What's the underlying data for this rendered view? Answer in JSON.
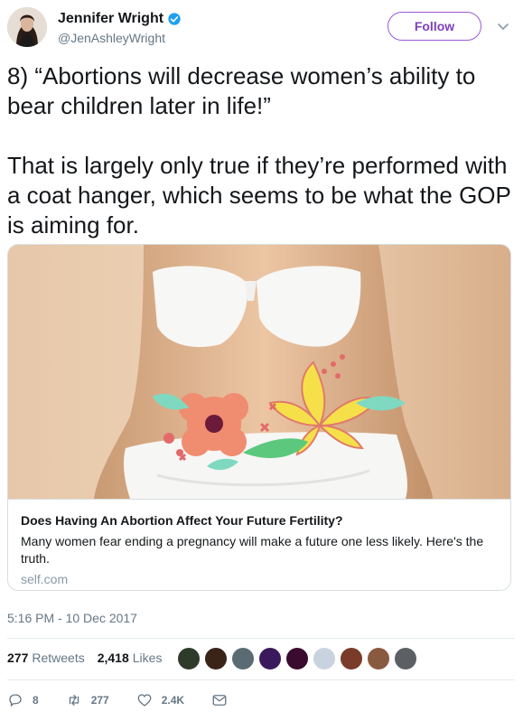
{
  "author": {
    "name": "Jennifer Wright",
    "handle": "@JenAshleyWright",
    "verified_icon": "verified-badge-icon"
  },
  "follow_label": "Follow",
  "tweet_text": "8) “Abortions will decrease women’s ability to bear children later in life!”\n\nThat is largely only true if they’re performed with a coat hanger, which seems to be what the GOP is aiming for.",
  "card": {
    "title": "Does Having An Abortion Affect Your Future Fertility?",
    "description": "Many women fear ending a pregnancy will make a future one less likely. Here's the truth.",
    "domain": "self.com"
  },
  "timestamp": "5:16 PM - 10 Dec 2017",
  "stats": {
    "retweets_count": "277",
    "retweets_label": "Retweets",
    "likes_count": "2,418",
    "likes_label": "Likes"
  },
  "likers": [
    "#2f3b2a",
    "#3a2418",
    "#5b6b73",
    "#3b1a5c",
    "#3a0b2e",
    "#c9d3e0",
    "#7a3b2b",
    "#8a5a40",
    "#5c5f63"
  ],
  "actions": {
    "replies": "8",
    "retweets": "277",
    "likes": "2.4K"
  },
  "colors": {
    "accent": "#7f3fbf",
    "secondary_text": "#657786",
    "verified": "#1da1f2"
  }
}
